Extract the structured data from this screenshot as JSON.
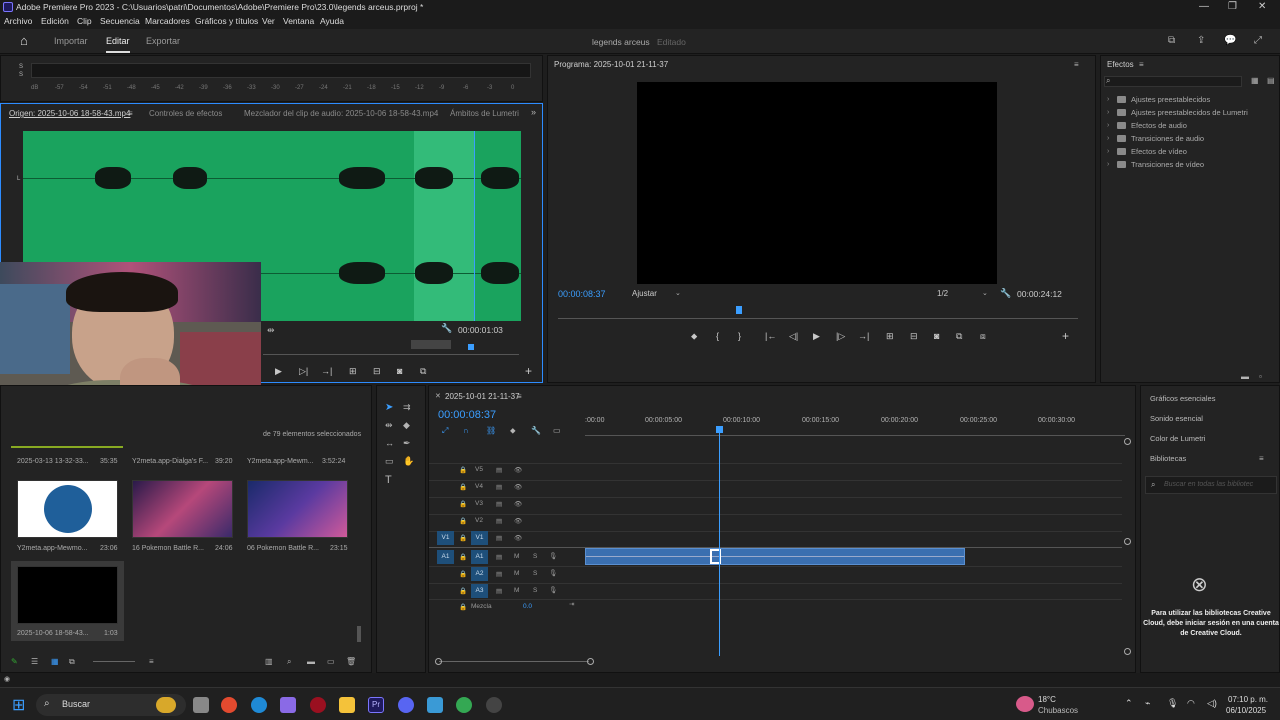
{
  "title_bar": {
    "title": "Adobe Premiere Pro 2023 - C:\\Usuarios\\patri\\Documentos\\Adobe\\Premiere Pro\\23.0\\legends arceus.prproj *"
  },
  "menu": [
    "Archivo",
    "Edición",
    "Clip",
    "Secuencia",
    "Marcadores",
    "Gráficos y títulos",
    "Ver",
    "Ventana",
    "Ayuda"
  ],
  "header": {
    "tabs": [
      "Importar",
      "Editar",
      "Exportar"
    ],
    "active_tab": "Editar",
    "project_name": "legends arceus",
    "project_status": "Editado"
  },
  "meter": {
    "ticks": [
      "dB",
      "-57",
      "-54",
      "-51",
      "-48",
      "-45",
      "-42",
      "-39",
      "-36",
      "-33",
      "-30",
      "-27",
      "-24",
      "-21",
      "-18",
      "-15",
      "-12",
      "-9",
      "-6",
      "-3",
      "0"
    ],
    "channels": [
      "S",
      "S"
    ]
  },
  "source": {
    "tabs": [
      "Origen: 2025-10-06 18-58-43.mp4",
      "Controles de efectos",
      "Mezclador del clip de audio: 2025-10-06 18-58-43.mp4",
      "Ámbitos de Lumetri"
    ],
    "channel_labels": [
      "L",
      "R"
    ],
    "timecode": "00:00:01:03"
  },
  "program": {
    "title": "Programa: 2025-10-01 21-11-37",
    "current_time": "00:00:08:37",
    "fit": "Ajustar",
    "resolution": "1/2",
    "duration": "00:00:24:12"
  },
  "effects": {
    "title": "Efectos",
    "items": [
      "Ajustes preestablecidos",
      "Ajustes preestablecidos de Lumetri",
      "Efectos de audio",
      "Transiciones de audio",
      "Efectos de vídeo",
      "Transiciones de vídeo"
    ]
  },
  "project": {
    "selection": "de 79 elementos seleccionados",
    "items": [
      {
        "name": "2025-03-13 13-32-33...",
        "dur": "35:35"
      },
      {
        "name": "Y2meta.app-Dialga's F...",
        "dur": "39:20"
      },
      {
        "name": "Y2meta.app-Mewm...",
        "dur": "3:52:24"
      },
      {
        "name": "Y2meta.app-Mewmo...",
        "dur": "23:06"
      },
      {
        "name": "16 Pokemon Battle R...",
        "dur": "24:06"
      },
      {
        "name": "06 Pokemon Battle R...",
        "dur": "23:15"
      },
      {
        "name": "2025-10-06 18-58-43...",
        "dur": "1:03"
      }
    ]
  },
  "timeline": {
    "sequence": "2025-10-01 21-11-37",
    "timecode": "00:00:08:37",
    "ruler": [
      ":00:00",
      "00:00:05:00",
      "00:00:10:00",
      "00:00:15:00",
      "00:00:20:00",
      "00:00:25:00",
      "00:00:30:00"
    ],
    "video_tracks": [
      "V5",
      "V4",
      "V3",
      "V2",
      "V1"
    ],
    "audio_tracks": [
      "A1",
      "A2",
      "A3"
    ],
    "src_video": "V1",
    "src_audio": "A1",
    "mix_label": "Mezcla",
    "mix_value": "0.0",
    "mute": "M",
    "solo": "S"
  },
  "right_panel": {
    "items": [
      "Gráficos esenciales",
      "Sonido esencial",
      "Color de Lumetri",
      "Bibliotecas"
    ],
    "search_placeholder": "Buscar en todas las bibliotec",
    "message": "Para utilizar las bibliotecas Creative Cloud, debe iniciar sesión en una cuenta de Creative Cloud."
  },
  "taskbar": {
    "search": "Buscar",
    "weather_temp": "18°C",
    "weather_desc": "Chubascos",
    "time": "07:10 p. m.",
    "date": "06/10/2025"
  }
}
